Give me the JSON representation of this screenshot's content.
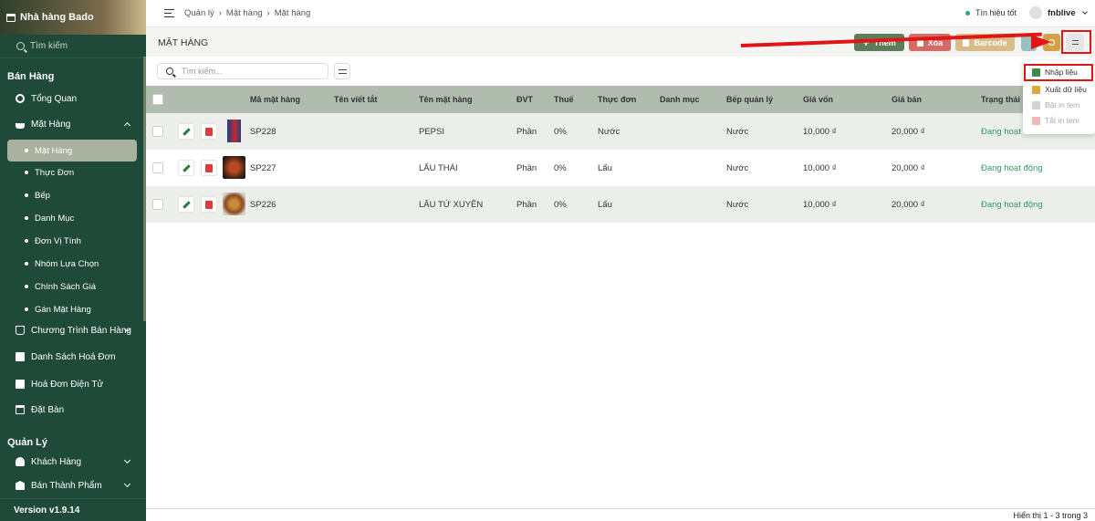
{
  "sidebar": {
    "brand": "Nhà hàng Bado",
    "search_placeholder": "Tìm kiếm",
    "section_sales": "Bán Hàng",
    "items": {
      "overview": "Tổng Quan",
      "products": "Mặt Hàng",
      "sales_program": "Chương Trình Bán Hàng",
      "invoices": "Danh Sách Hoá Đơn",
      "einvoice": "Hoá Đơn Điện Tử",
      "booking": "Đặt Bàn"
    },
    "sub_items": [
      "Mặt Hàng",
      "Thực Đơn",
      "Bếp",
      "Danh Mục",
      "Đơn Vị Tính",
      "Nhóm Lựa Chọn",
      "Chính Sách Giá",
      "Gán Mặt Hàng"
    ],
    "section_manage": "Quản Lý",
    "manage_items": {
      "customers": "Khách Hàng",
      "semi": "Bán Thành Phẩm"
    },
    "version": "Version v1.9.14"
  },
  "topbar": {
    "breadcrumb": [
      "Quản lý",
      "Mặt hàng",
      "Mặt hàng"
    ],
    "signal": "Tín hiệu tốt",
    "username": "fnblive"
  },
  "page": {
    "title": "MẶT HÀNG",
    "btn_add": "Thêm",
    "btn_delete": "Xóa",
    "btn_barcode": "Barcode",
    "search_placeholder": "Tìm kiếm..."
  },
  "table": {
    "columns": [
      "Mã mặt hàng",
      "Tên viết tắt",
      "Tên mặt hàng",
      "ĐVT",
      "Thuế",
      "Thực đơn",
      "Danh mục",
      "Bếp quản lý",
      "Giá vốn",
      "Giá bán",
      "Trạng thái"
    ],
    "rows": [
      {
        "code": "SP228",
        "abbr": "",
        "name": "PEPSI",
        "unit": "Phần",
        "tax": "0%",
        "menu": "Nước",
        "category": "",
        "kitchen": "Nước",
        "cost": "10,000 ₫",
        "price": "20,000 ₫",
        "status": "Đang hoạt đ"
      },
      {
        "code": "SP227",
        "abbr": "",
        "name": "LẨU THÁI",
        "unit": "Phần",
        "tax": "0%",
        "menu": "Lẩu",
        "category": "",
        "kitchen": "Nước",
        "cost": "10,000 ₫",
        "price": "20,000 ₫",
        "status": "Đang hoạt động"
      },
      {
        "code": "SP226",
        "abbr": "",
        "name": "LẨU TỨ XUYÊN",
        "unit": "Phần",
        "tax": "0%",
        "menu": "Lẩu",
        "category": "",
        "kitchen": "Nước",
        "cost": "10,000 ₫",
        "price": "20,000 ₫",
        "status": "Đang hoạt động"
      }
    ]
  },
  "dropdown": {
    "items": [
      "Nhập liệu",
      "Xuất dữ liệu",
      "Bật in tem",
      "Tắt in tem"
    ]
  },
  "footer": {
    "pagination": "Hiển thị 1 - 3 trong 3"
  },
  "colors": {
    "sidebar": "#1f4a3a",
    "accent": "#5d7d5a",
    "danger": "#d36b67",
    "status": "#2f9a61",
    "highlight": "#e01616"
  }
}
